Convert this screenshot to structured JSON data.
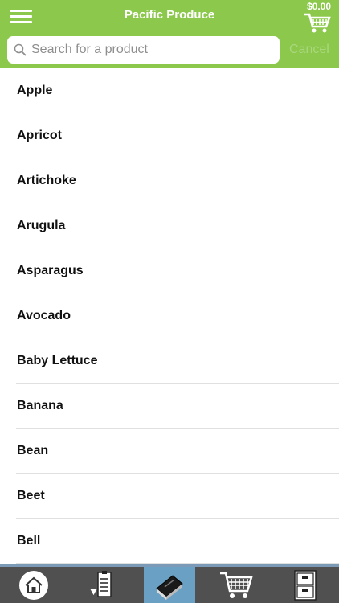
{
  "header": {
    "title": "Pacific Produce",
    "cart_total": "$0.00"
  },
  "search": {
    "placeholder": "Search for a product",
    "value": "",
    "cancel_label": "Cancel"
  },
  "products": [
    "Apple",
    "Apricot",
    "Artichoke",
    "Arugula",
    "Asparagus",
    "Avocado",
    "Baby Lettuce",
    "Banana",
    "Bean",
    "Beet",
    "Bell"
  ],
  "tabbar": {
    "tabs": [
      {
        "icon": "home-icon",
        "active": false
      },
      {
        "icon": "order-guide-icon",
        "active": false
      },
      {
        "icon": "catalog-book-icon",
        "active": true
      },
      {
        "icon": "cart-icon",
        "active": false
      },
      {
        "icon": "file-cabinet-icon",
        "active": false
      }
    ]
  },
  "colors": {
    "header": "#8cc84b",
    "tabbar": "#505050",
    "active_tab": "#6aa0c3"
  }
}
